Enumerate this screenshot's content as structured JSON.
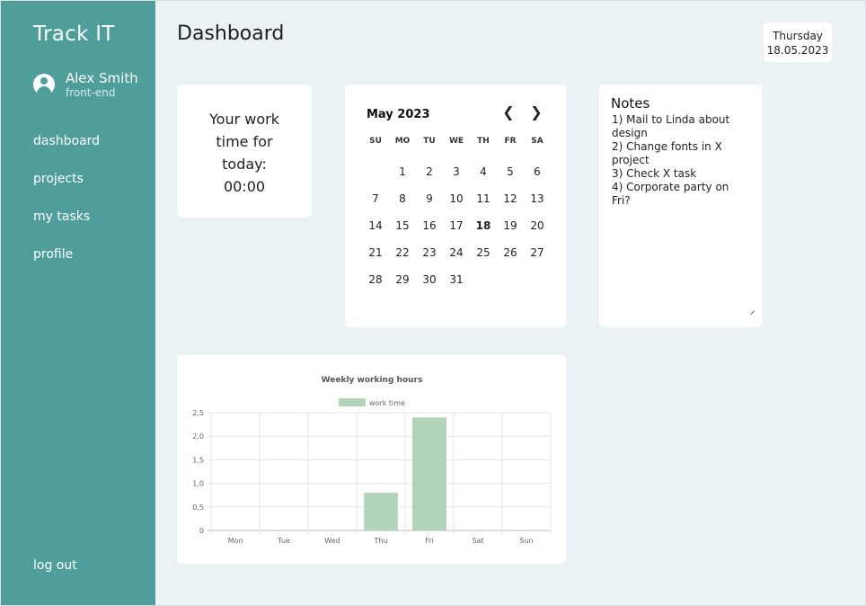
{
  "app": {
    "brand": "Track IT"
  },
  "user": {
    "name": "Alex Smith",
    "role": "front-end"
  },
  "nav": {
    "items": [
      "dashboard",
      "projects",
      "my tasks",
      "profile"
    ],
    "logout": "log out"
  },
  "header": {
    "title": "Dashboard",
    "weekday": "Thursday",
    "date": "18.05.2023"
  },
  "work_time": {
    "line1": "Your work",
    "line2": "time for",
    "line3": "today:",
    "value": "00:00"
  },
  "calendar": {
    "month_label": "May 2023",
    "prev_icon": "chevron-left-icon",
    "next_icon": "chevron-right-icon",
    "weekdays": [
      "SU",
      "MO",
      "TU",
      "WE",
      "TH",
      "FR",
      "SA"
    ],
    "leading_blanks": 1,
    "days": 31,
    "selected_day": 18
  },
  "notes": {
    "title": "Notes",
    "text": "1) Mail to Linda about design\n2) Change fonts in X project\n3) Check X task\n4) Corporate party on Fri?"
  },
  "colors": {
    "sidebar": "#4f9e9c",
    "background": "#eaf2f3",
    "bar": "#b2d3bb"
  },
  "chart_data": {
    "type": "bar",
    "title": "Weekly working hours",
    "categories": [
      "Mon",
      "Tue",
      "Wed",
      "Thu",
      "Fri",
      "Sat",
      "Sun"
    ],
    "series": [
      {
        "name": "work time",
        "values": [
          0,
          0,
          0,
          0.8,
          2.4,
          0,
          0
        ]
      }
    ],
    "ylim": [
      0,
      2.5
    ],
    "yticks": [
      "0",
      "0,5",
      "1,0",
      "1,5",
      "2,0",
      "2,5"
    ],
    "legend": "top",
    "grid": true
  }
}
